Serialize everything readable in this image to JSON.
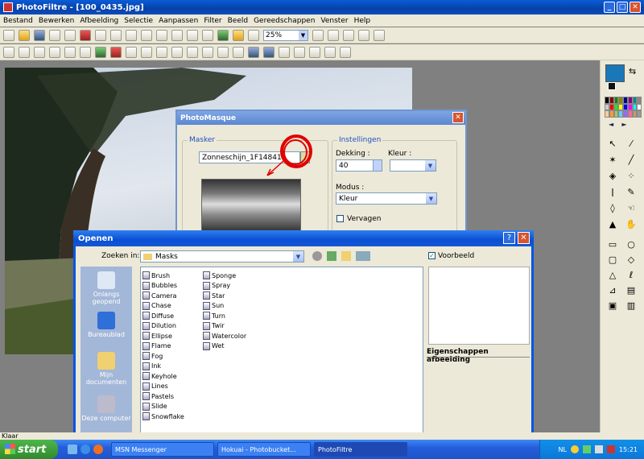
{
  "app": {
    "title": "PhotoFiltre - [100_0435.jpg]"
  },
  "menu": [
    "Bestand",
    "Bewerken",
    "Afbeelding",
    "Selectie",
    "Aanpassen",
    "Filter",
    "Beeld",
    "Gereedschappen",
    "Venster",
    "Help"
  ],
  "toolbar": {
    "zoom": "25%"
  },
  "photomasque": {
    "title": "PhotoMasque",
    "masker_label": "Masker",
    "masker_value": "Zonneschijn_1F14841h",
    "instellingen_label": "Instellingen",
    "dekking_label": "Dekking :",
    "dekking_value": "40",
    "kleur_label": "Kleur :",
    "modus_label": "Modus :",
    "modus_value": "Kleur",
    "vervagen_label": "Vervagen"
  },
  "open_dialog": {
    "title": "Openen",
    "zoeken_label": "Zoeken in:",
    "folder": "Masks",
    "voorbeeld_label": "Voorbeeld",
    "eigenschappen_label": "Eigenschappen afbeelding",
    "places": [
      "Onlangs geopend",
      "Bureaublad",
      "Mijn documenten",
      "Deze computer"
    ],
    "files_col1": [
      "Brush",
      "Bubbles",
      "Camera",
      "Chase",
      "Diffuse",
      "Dilution",
      "Ellipse",
      "Flame",
      "Fog",
      "Ink",
      "Keyhole",
      "Lines",
      "Pastels",
      "Slide",
      "Snowflake"
    ],
    "files_col2": [
      "Sponge",
      "Spray",
      "Star",
      "Sun",
      "Turn",
      "Twir",
      "Watercolor",
      "Wet"
    ]
  },
  "status": {
    "text": "Klaar"
  },
  "taskbar": {
    "start": "start",
    "tasks": [
      "MSN Messenger",
      "Hokuai - Photobucket...",
      "PhotoFiltre"
    ],
    "lang": "NL",
    "time": "15:21"
  },
  "colors": {
    "foreground": "#1a78b8",
    "xp_blue": "#0055e5",
    "annotation": "#e00000"
  }
}
